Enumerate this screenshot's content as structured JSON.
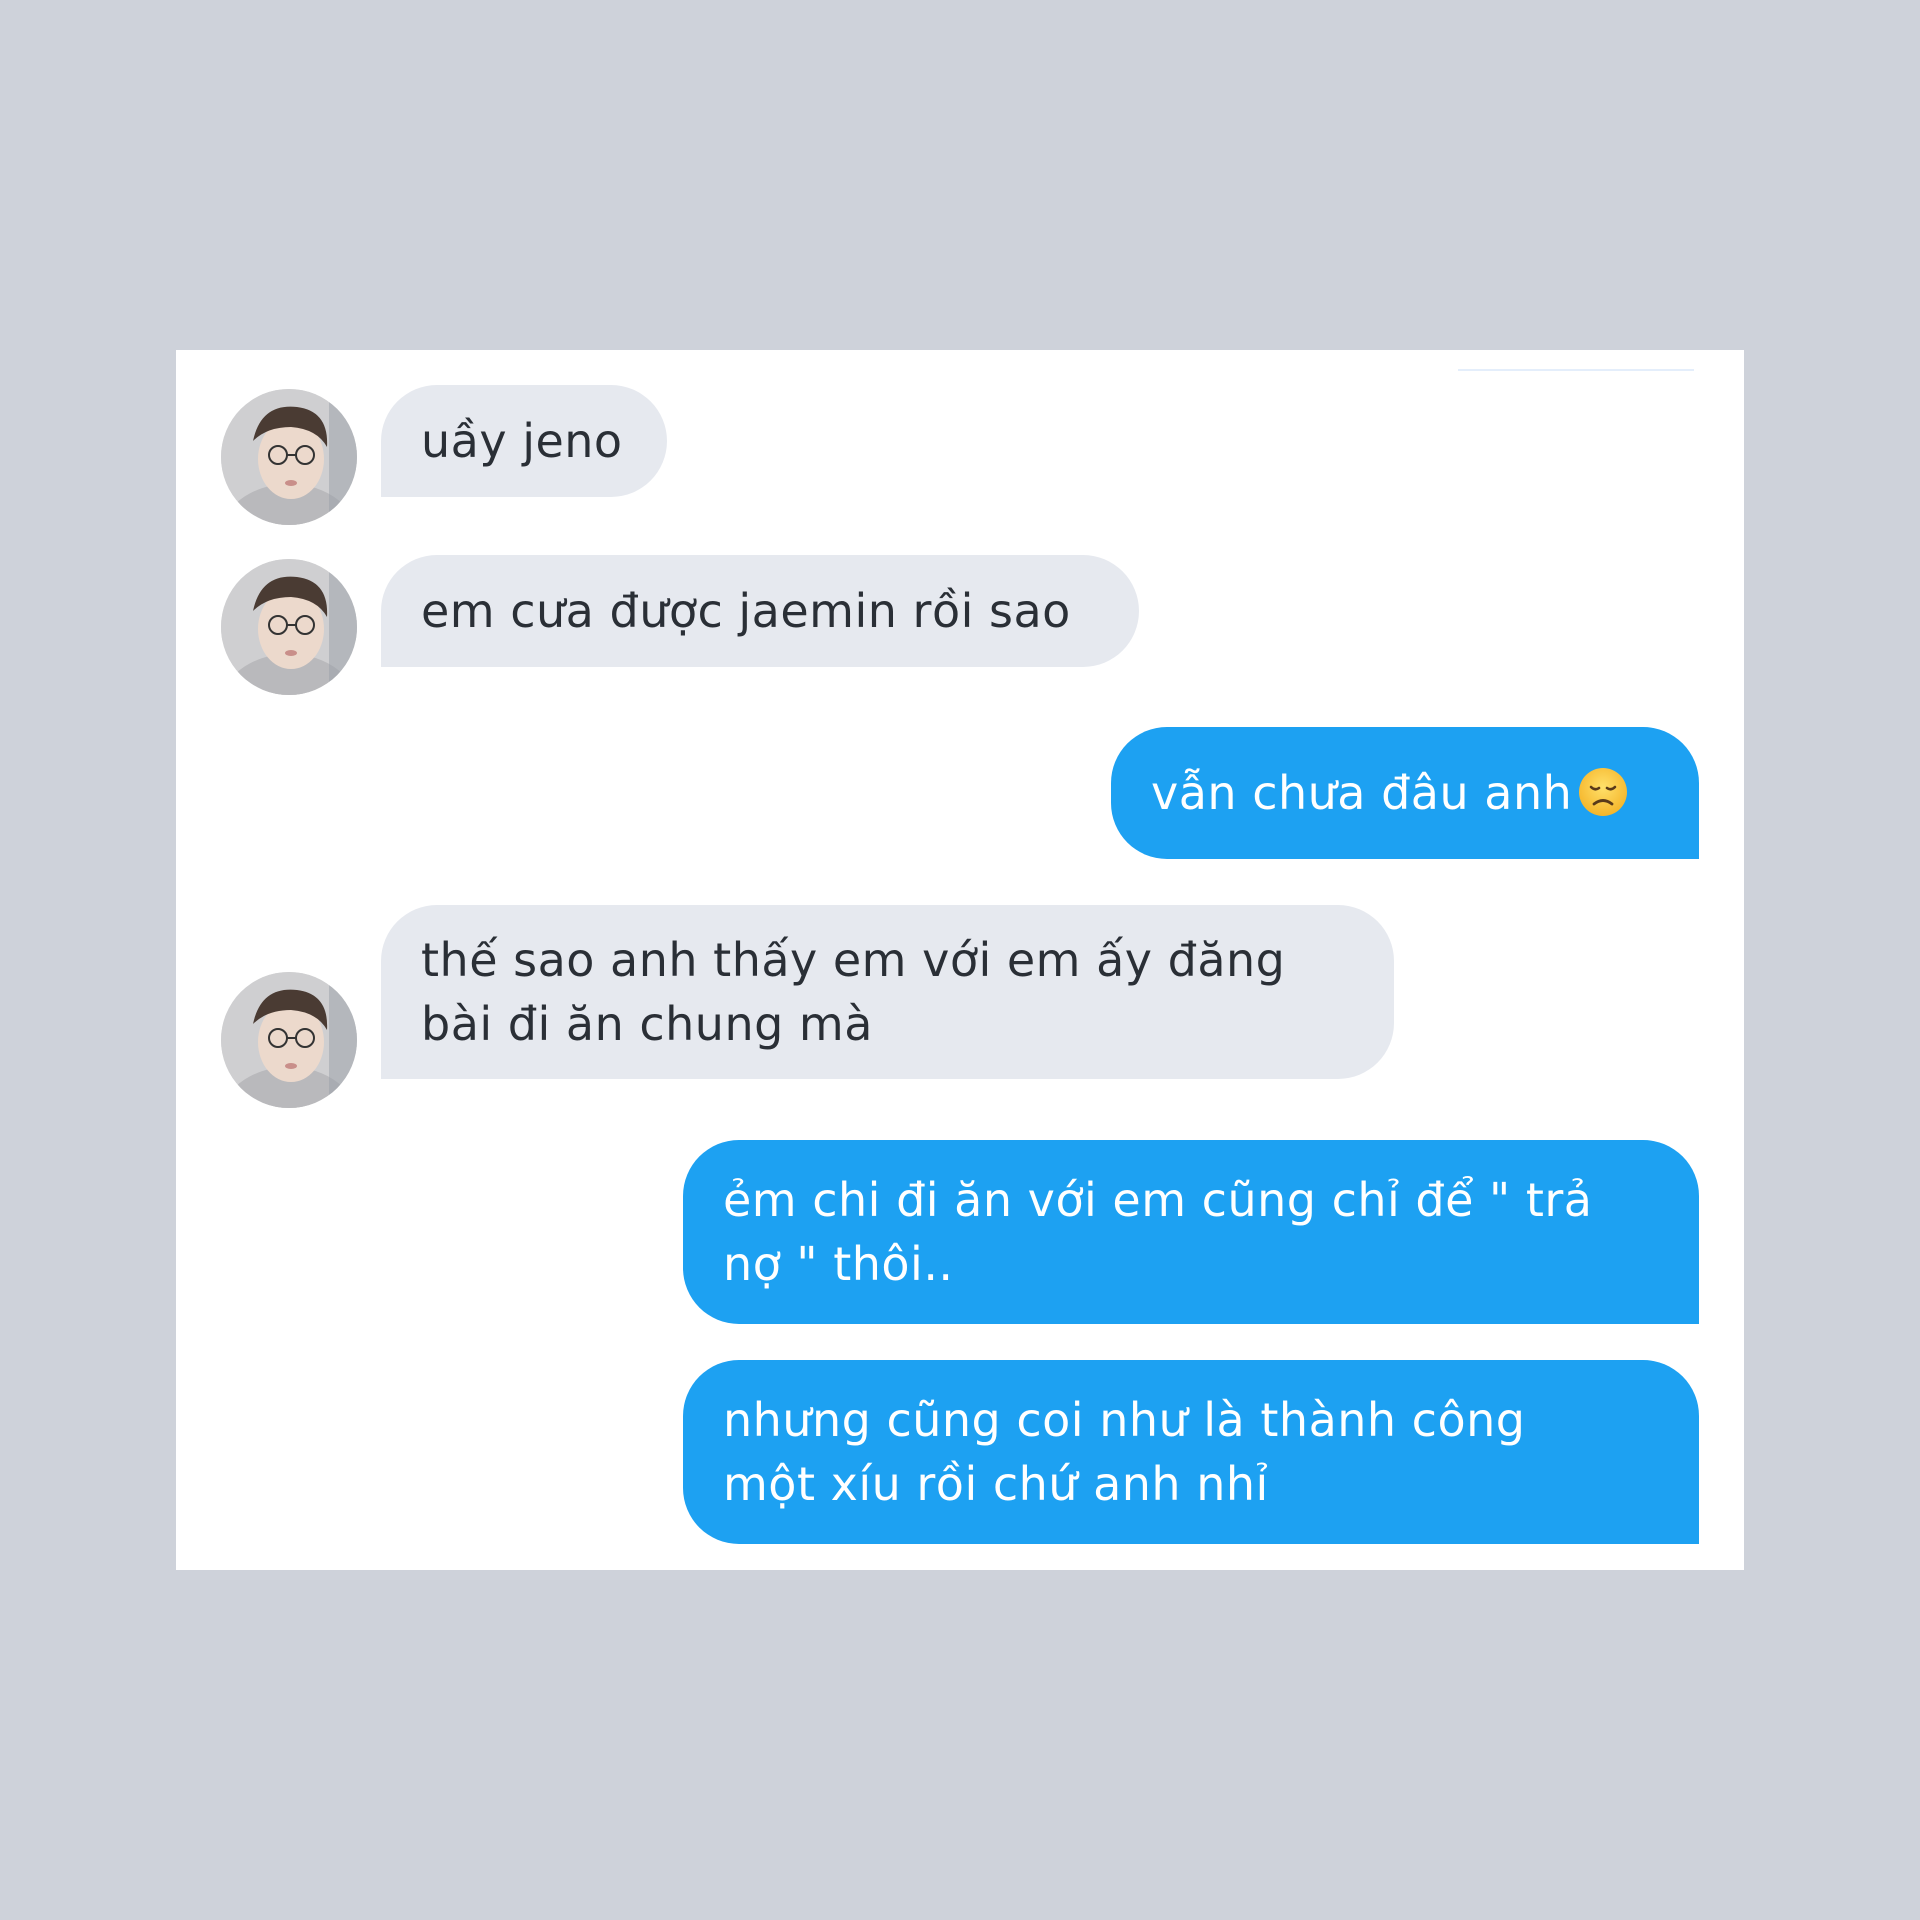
{
  "conversation": {
    "messages": [
      {
        "sender": "other",
        "lines": [
          "uầy jeno"
        ]
      },
      {
        "sender": "other",
        "lines": [
          "em cưa được jaemin rồi sao"
        ]
      },
      {
        "sender": "me",
        "lines": [
          "vẫn chưa đâu anh"
        ],
        "emoji": "disappointed-face"
      },
      {
        "sender": "other",
        "lines": [
          "thế sao anh thấy em với em ấy đăng",
          "bài đi ăn chung mà"
        ]
      },
      {
        "sender": "me",
        "lines": [
          "ẻm chi đi ăn với em cũng chỉ để \" trả",
          "nợ \" thôi.."
        ]
      },
      {
        "sender": "me",
        "lines": [
          "nhưng cũng coi như là thành công",
          "một xíu rồi chứ anh nhỉ"
        ]
      }
    ]
  },
  "colors": {
    "background": "#ced2da",
    "card": "#ffffff",
    "incoming_bubble": "#e6e9ef",
    "incoming_text": "#2a2f36",
    "outgoing_bubble": "#1da1f2",
    "outgoing_text": "#ffffff"
  },
  "icons": {
    "avatar": "user-avatar-photo",
    "emoji": "disappointed-face-emoji"
  }
}
